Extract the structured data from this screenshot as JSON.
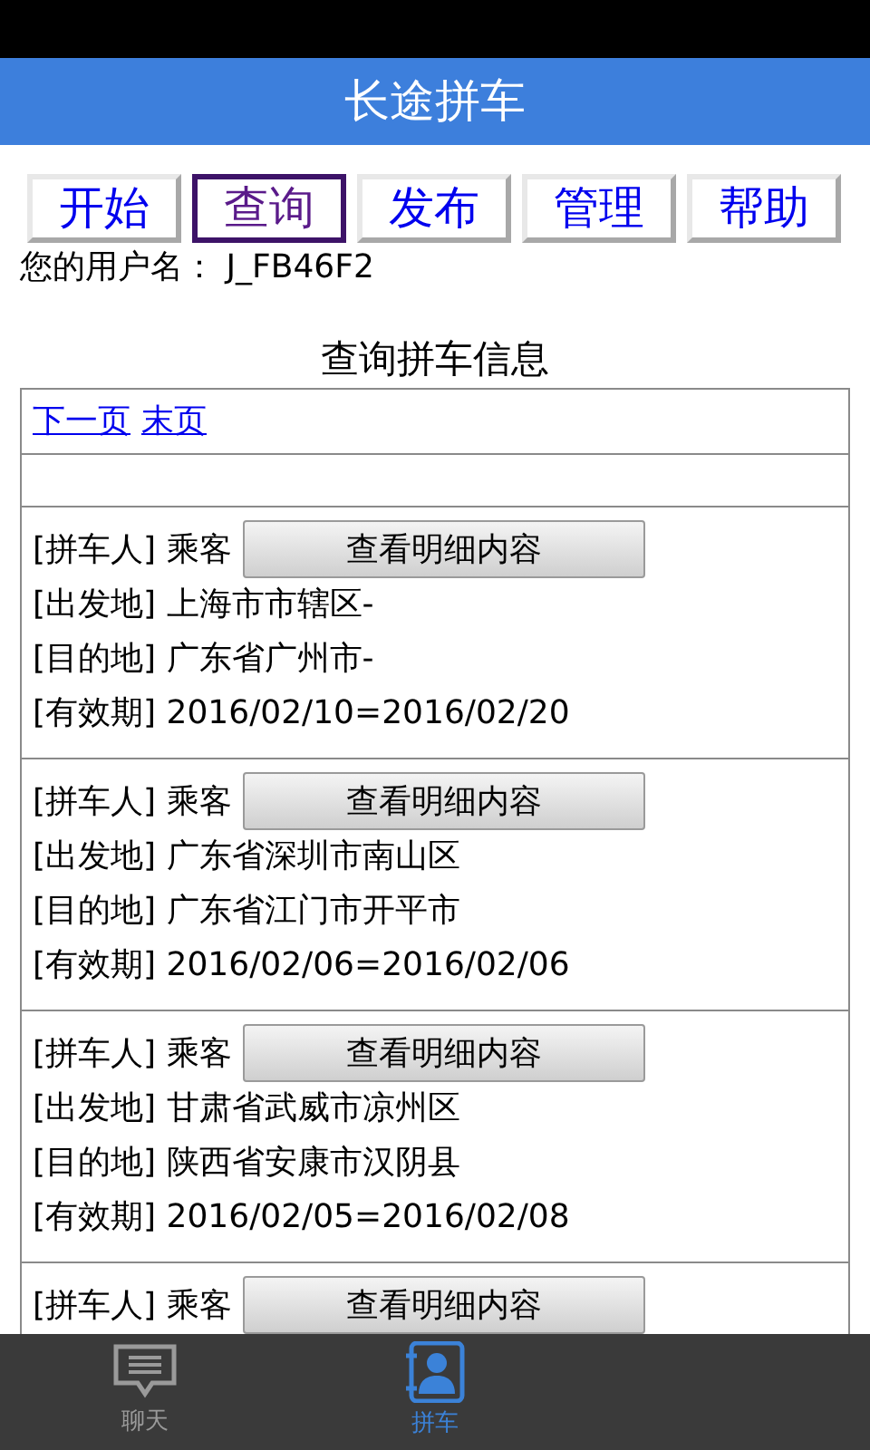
{
  "header": {
    "title": "长途拼车"
  },
  "tabs": [
    {
      "label": "开始",
      "selected": false
    },
    {
      "label": "查询",
      "selected": true
    },
    {
      "label": "发布",
      "selected": false
    },
    {
      "label": "管理",
      "selected": false
    },
    {
      "label": "帮助",
      "selected": false
    }
  ],
  "username": "您的用户名： J_FB46F2",
  "section_title": "查询拼车信息",
  "pager": [
    "下一页",
    "末页"
  ],
  "listings": [
    {
      "role": "[拼车人] 乘客",
      "button": "查看明细内容",
      "lines": [
        "[出发地] 上海市市辖区-",
        "[目的地] 广东省广州市-",
        "[有效期] 2016/02/10=2016/02/20"
      ]
    },
    {
      "role": "[拼车人] 乘客",
      "button": "查看明细内容",
      "lines": [
        "[出发地] 广东省深圳市南山区",
        "[目的地] 广东省江门市开平市",
        "[有效期] 2016/02/06=2016/02/06"
      ]
    },
    {
      "role": "[拼车人] 乘客",
      "button": "查看明细内容",
      "lines": [
        "[出发地] 甘肃省武威市凉州区",
        "[目的地] 陕西省安康市汉阴县",
        "[有效期] 2016/02/05=2016/02/08"
      ]
    },
    {
      "role": "[拼车人] 乘客",
      "button": "查看明细内容"
    }
  ],
  "bottom_nav": [
    {
      "label": "聊天",
      "kind": "chat",
      "selected": false
    },
    {
      "label": "拼车",
      "kind": "contacts",
      "selected": true
    }
  ]
}
